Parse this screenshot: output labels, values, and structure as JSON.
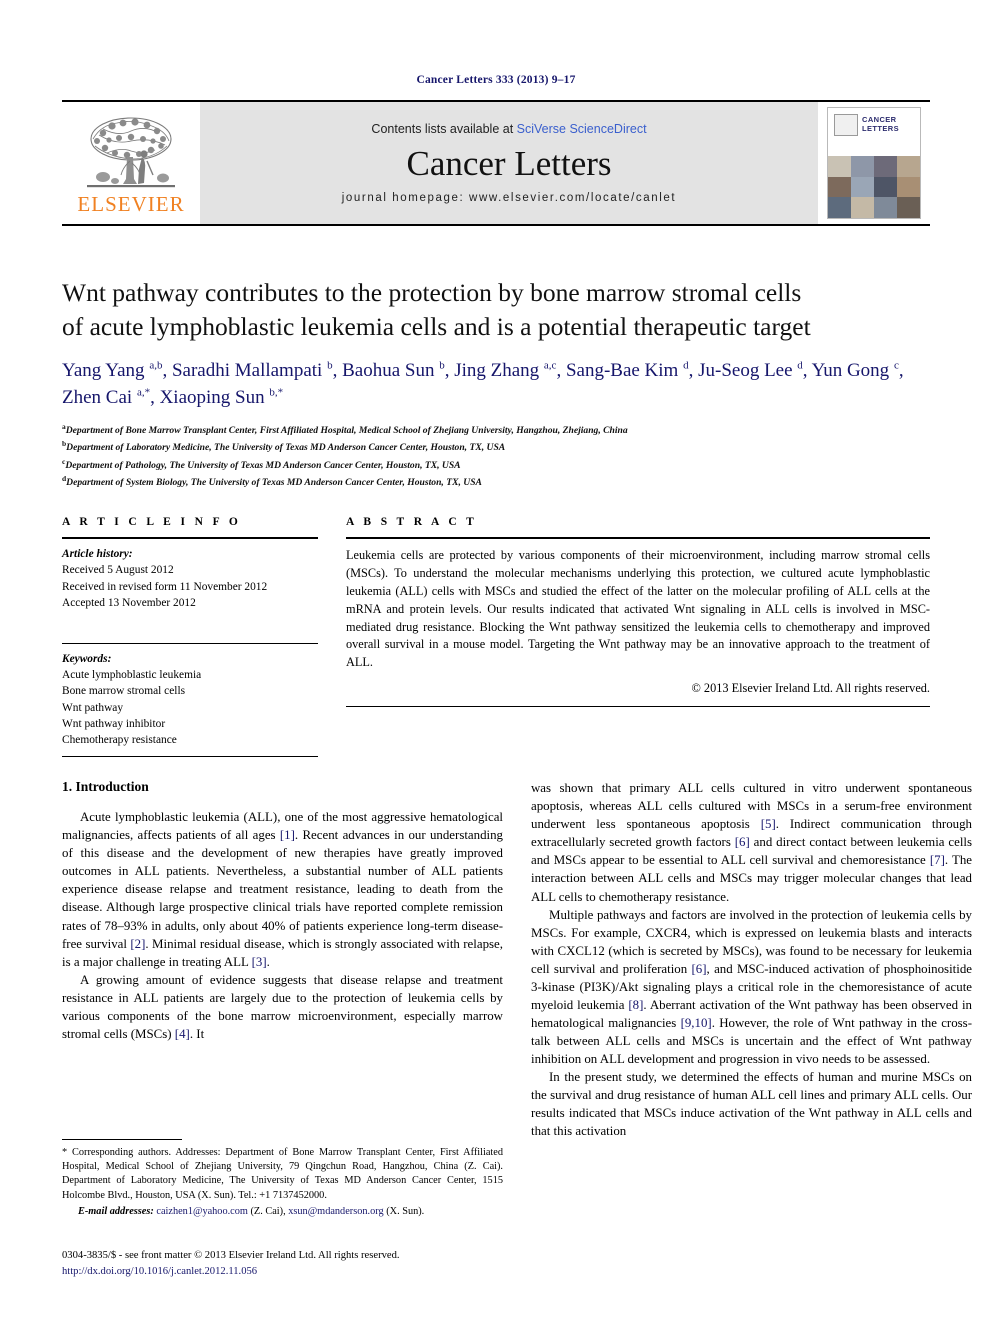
{
  "running_head": "Cancer Letters 333 (2013) 9–17",
  "masthead": {
    "publisher_name": "ELSEVIER",
    "contents_prefix": "Contents lists available at ",
    "contents_link": "SciVerse ScienceDirect",
    "journal_title": "Cancer Letters",
    "homepage": "journal homepage: www.elsevier.com/locate/canlet",
    "cover_title_line1": "CANCER",
    "cover_title_line2": "LETTERS"
  },
  "article": {
    "title": "Wnt pathway contributes to the protection by bone marrow stromal cells of acute lymphoblastic leukemia cells and is a potential therapeutic target",
    "authors": "Yang Yang a,b, Saradhi Mallampati b, Baohua Sun b, Jing Zhang a,c, Sang-Bae Kim d, Ju-Seog Lee d, Yun Gong c, Zhen Cai a,*, Xiaoping Sun b,*",
    "affiliations": [
      {
        "marker": "a",
        "text": "Department of Bone Marrow Transplant Center, First Affiliated Hospital, Medical School of Zhejiang University, Hangzhou, Zhejiang, China"
      },
      {
        "marker": "b",
        "text": "Department of Laboratory Medicine, The University of Texas MD Anderson Cancer Center, Houston, TX, USA"
      },
      {
        "marker": "c",
        "text": "Department of Pathology, The University of Texas MD Anderson Cancer Center, Houston, TX, USA"
      },
      {
        "marker": "d",
        "text": "Department of System Biology, The University of Texas MD Anderson Cancer Center, Houston, TX, USA"
      }
    ]
  },
  "article_info": {
    "label": "A R T I C L E   I N F O",
    "history_label": "Article history:",
    "history": [
      "Received 5 August 2012",
      "Received in revised form 11 November 2012",
      "Accepted 13 November 2012"
    ],
    "keywords_label": "Keywords:",
    "keywords": [
      "Acute lymphoblastic leukemia",
      "Bone marrow stromal cells",
      "Wnt pathway",
      "Wnt pathway inhibitor",
      "Chemotherapy resistance"
    ]
  },
  "abstract": {
    "label": "A B S T R A C T",
    "text": "Leukemia cells are protected by various components of their microenvironment, including marrow stromal cells (MSCs). To understand the molecular mechanisms underlying this protection, we cultured acute lymphoblastic leukemia (ALL) cells with MSCs and studied the effect of the latter on the molecular profiling of ALL cells at the mRNA and protein levels. Our results indicated that activated Wnt signaling in ALL cells is involved in MSC-mediated drug resistance. Blocking the Wnt pathway sensitized the leukemia cells to chemotherapy and improved overall survival in a mouse model. Targeting the Wnt pathway may be an innovative approach to the treatment of ALL.",
    "copyright": "© 2013 Elsevier Ireland Ltd. All rights reserved."
  },
  "introduction": {
    "heading": "1. Introduction",
    "left_paragraphs": [
      "Acute lymphoblastic leukemia (ALL), one of the most aggressive hematological malignancies, affects patients of all ages [1]. Recent advances in our understanding of this disease and the development of new therapies have greatly improved outcomes in ALL patients. Nevertheless, a substantial number of ALL patients experience disease relapse and treatment resistance, leading to death from the disease. Although large prospective clinical trials have reported complete remission rates of 78–93% in adults, only about 40% of patients experience long-term disease-free survival [2]. Minimal residual disease, which is strongly associated with relapse, is a major challenge in treating ALL [3].",
      "A growing amount of evidence suggests that disease relapse and treatment resistance in ALL patients are largely due to the protection of leukemia cells by various components of the bone marrow microenvironment, especially marrow stromal cells (MSCs) [4]. It"
    ],
    "right_paragraphs": [
      "was shown that primary ALL cells cultured in vitro underwent spontaneous apoptosis, whereas ALL cells cultured with MSCs in a serum-free environment underwent less spontaneous apoptosis [5]. Indirect communication through extracellularly secreted growth factors [6] and direct contact between leukemia cells and MSCs appear to be essential to ALL cell survival and chemoresistance [7]. The interaction between ALL cells and MSCs may trigger molecular changes that lead ALL cells to chemotherapy resistance.",
      "Multiple pathways and factors are involved in the protection of leukemia cells by MSCs. For example, CXCR4, which is expressed on leukemia blasts and interacts with CXCL12 (which is secreted by MSCs), was found to be necessary for leukemia cell survival and proliferation [6], and MSC-induced activation of phosphoinositide 3-kinase (PI3K)/Akt signaling plays a critical role in the chemoresistance of acute myeloid leukemia [8]. Aberrant activation of the Wnt pathway has been observed in hematological malignancies [9,10]. However, the role of Wnt pathway in the cross-talk between ALL cells and MSCs is uncertain and the effect of Wnt pathway inhibition on ALL development and progression in vivo needs to be assessed.",
      "In the present study, we determined the effects of human and murine MSCs on the survival and drug resistance of human ALL cell lines and primary ALL cells. Our results indicated that MSCs induce activation of the Wnt pathway in ALL cells and that this activation"
    ]
  },
  "footnote": {
    "corresponding": "* Corresponding authors. Addresses: Department of Bone Marrow Transplant Center, First Affiliated Hospital, Medical School of Zhejiang University, 79 Qingchun Road, Hangzhou, China (Z. Cai). Department of Laboratory Medicine, The University of Texas MD Anderson Cancer Center, 1515 Holcombe Blvd., Houston, USA (X. Sun). Tel.: +1 7137452000.",
    "email_label": "E-mail addresses:",
    "email_1": "caizhen1@yahoo.com",
    "email_1_owner": "(Z. Cai),",
    "email_2": "xsun@mdanderson.org",
    "email_2_owner": "(X. Sun)."
  },
  "imprint": {
    "issn_line": "0304-3835/$ - see front matter © 2013 Elsevier Ireland Ltd. All rights reserved.",
    "doi": "http://dx.doi.org/10.1016/j.canlet.2012.11.056"
  },
  "colors": {
    "link_blue": "#3a5fcd",
    "ref_blue": "#16166b",
    "elsevier_orange": "#f08122",
    "masthead_gray": "#e3e3e3"
  }
}
